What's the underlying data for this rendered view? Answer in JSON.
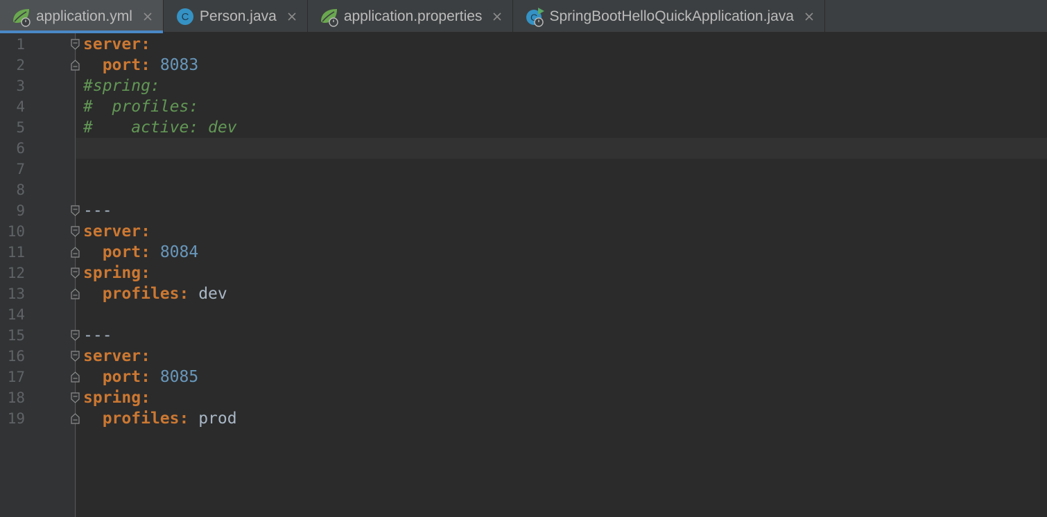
{
  "tabs": [
    {
      "label": "application.yml",
      "icon": "spring-config-icon",
      "active": true
    },
    {
      "label": "Person.java",
      "icon": "java-class-icon",
      "active": false
    },
    {
      "label": "application.properties",
      "icon": "spring-config-icon",
      "active": false
    },
    {
      "label": "SpringBootHelloQuickApplication.java",
      "icon": "spring-boot-run-icon",
      "active": false
    }
  ],
  "colors": {
    "background": "#2b2b2b",
    "gutter": "#313335",
    "key": "#cc7832",
    "number": "#6897bb",
    "comment": "#629755",
    "text": "#a9b7c6",
    "tab_underline": "#4a88c7"
  },
  "editor": {
    "lines": [
      {
        "num": "1",
        "key": "server:",
        "value": "",
        "vtype": "",
        "comment": "",
        "fold": "start"
      },
      {
        "num": "2",
        "key": "port:",
        "value": "8083",
        "vtype": "n",
        "comment": "",
        "fold": "end"
      },
      {
        "num": "3",
        "key": "",
        "value": "",
        "vtype": "",
        "comment": "#spring:",
        "fold": ""
      },
      {
        "num": "4",
        "key": "",
        "value": "",
        "vtype": "",
        "comment": "#  profiles:",
        "fold": ""
      },
      {
        "num": "5",
        "key": "",
        "value": "",
        "vtype": "",
        "comment": "#    active: dev",
        "fold": ""
      },
      {
        "num": "6",
        "key": "",
        "value": "",
        "vtype": "",
        "comment": "",
        "fold": ""
      },
      {
        "num": "7",
        "key": "",
        "value": "",
        "vtype": "",
        "comment": "",
        "fold": ""
      },
      {
        "num": "8",
        "key": "",
        "value": "",
        "vtype": "",
        "comment": "",
        "fold": ""
      },
      {
        "num": "9",
        "key": "",
        "value": "",
        "vtype": "",
        "comment": "",
        "doc": "---",
        "fold": "start"
      },
      {
        "num": "10",
        "key": "server:",
        "value": "",
        "vtype": "",
        "comment": "",
        "fold": "start"
      },
      {
        "num": "11",
        "key": "port:",
        "value": "8084",
        "vtype": "n",
        "comment": "",
        "fold": "end"
      },
      {
        "num": "12",
        "key": "spring:",
        "value": "",
        "vtype": "",
        "comment": "",
        "fold": "start"
      },
      {
        "num": "13",
        "key": "profiles:",
        "value": "dev",
        "vtype": "v",
        "comment": "",
        "fold": "end"
      },
      {
        "num": "14",
        "key": "",
        "value": "",
        "vtype": "",
        "comment": "",
        "fold": ""
      },
      {
        "num": "15",
        "key": "",
        "value": "",
        "vtype": "",
        "comment": "",
        "doc": "---",
        "fold": "start"
      },
      {
        "num": "16",
        "key": "server:",
        "value": "",
        "vtype": "",
        "comment": "",
        "fold": "start"
      },
      {
        "num": "17",
        "key": "port:",
        "value": "8085",
        "vtype": "n",
        "comment": "",
        "fold": "end"
      },
      {
        "num": "18",
        "key": "spring:",
        "value": "",
        "vtype": "",
        "comment": "",
        "fold": "start"
      },
      {
        "num": "19",
        "key": "profiles:",
        "value": "prod",
        "vtype": "v",
        "comment": "",
        "fold": "end"
      }
    ]
  }
}
